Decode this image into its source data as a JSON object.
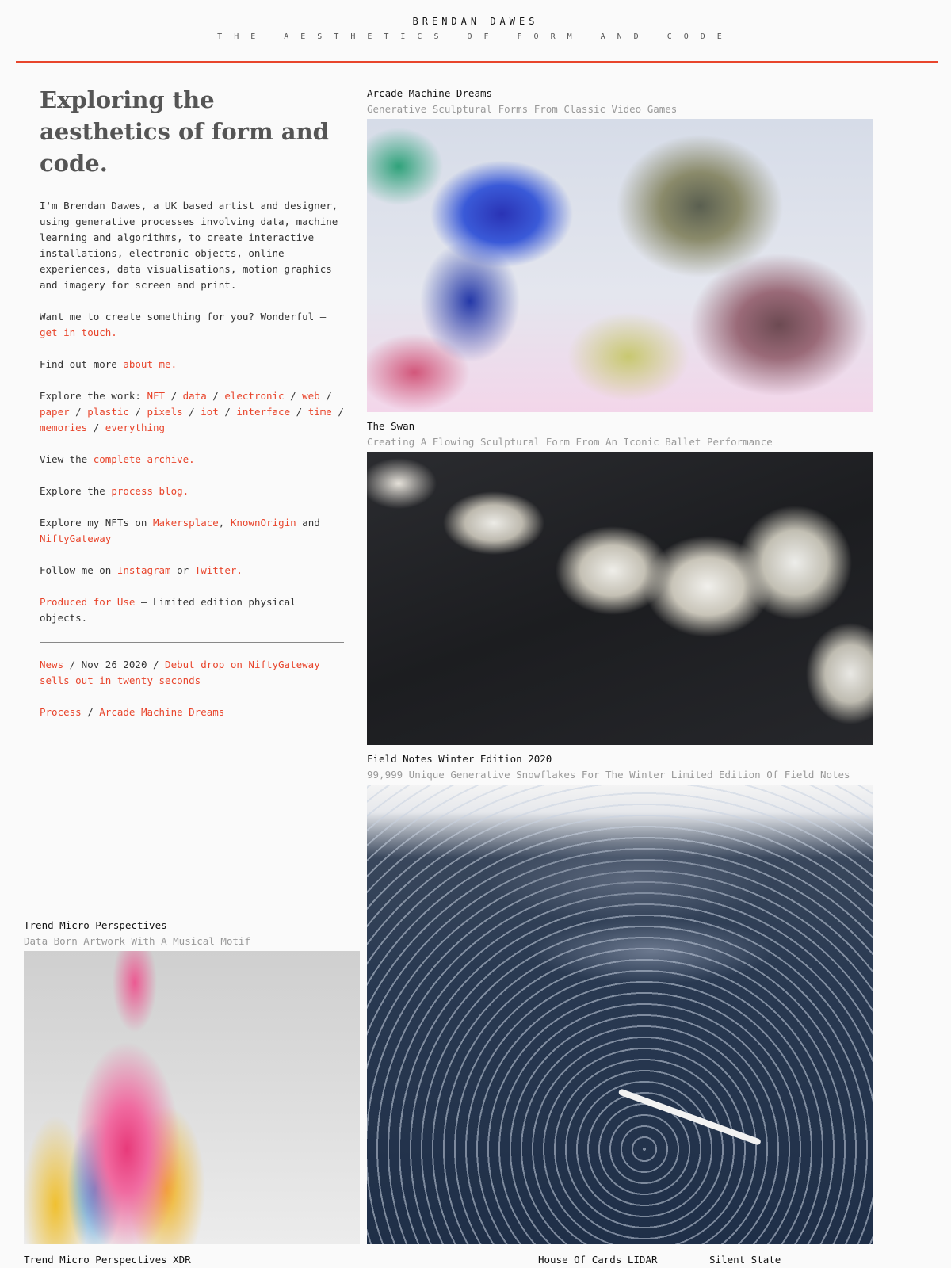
{
  "header": {
    "title": "BRENDAN DAWES",
    "tagline": "THE AESTHETICS OF FORM AND CODE"
  },
  "intro": {
    "heading": "Exploring the aesthetics of form and code.",
    "bio": "I'm Brendan Dawes, a UK based artist and designer, using generative processes involving data, machine learning and algorithms, to create interactive installations, electronic objects, online experiences, data visualisations, motion graphics and imagery for screen and print.",
    "contact_text": "Want me to create something for you? Wonderful — ",
    "contact_link": "get in touch.",
    "about_text": "Find out more ",
    "about_link": "about me.",
    "explore_text": "Explore the work: ",
    "work_links": [
      "NFT",
      "data",
      "electronic",
      "web",
      "pa­per",
      "plastic",
      "pixels",
      "iot",
      "interface",
      "time",
      "memories",
      "everything"
    ],
    "separator": " / ",
    "archive_text": "View the ",
    "archive_link": "complete archive.",
    "blog_text": "Explore the ",
    "blog_link": "process blog.",
    "nft_text": "Explore my NFTs on ",
    "nft_links": [
      "Makersplace",
      "KnownOrigin",
      "NiftyGateway"
    ],
    "nft_sep_comma": ", ",
    "nft_and": " and ",
    "follow_text": "Follow me on ",
    "follow_links": [
      "Instagram",
      "Twitter."
    ],
    "follow_or": " or ",
    "produced_link": "Produced for Use",
    "produced_text": " — Limited edition physical objects.",
    "news": {
      "label": "News",
      "date": " / Nov 26 2020 / ",
      "headline": "Debut drop on NiftyGateway sells out in twenty seconds"
    },
    "process": {
      "label": "Process",
      "sep": " / ",
      "title": "Arcade Machine Dreams"
    }
  },
  "projects": [
    {
      "title": "Arcade Machine Dreams",
      "subtitle": "Generative Sculptural Forms From Classic Video Games"
    },
    {
      "title": "The Swan",
      "subtitle": "Creating A Flowing Sculptural Form From An Iconic Ballet Performance"
    },
    {
      "title": "Field Notes Winter Edition 2020",
      "subtitle": "99,999 Unique Generative Snowflakes For The Winter Limited Edition Of Field Notes"
    },
    {
      "title": "Trend Micro Perspectives",
      "subtitle": "Data Born Artwork With A Musical Motif"
    }
  ],
  "bottom_titles": [
    "Trend Micro Perspectives XDR",
    "House Of Cards LIDAR",
    "Silent State"
  ]
}
